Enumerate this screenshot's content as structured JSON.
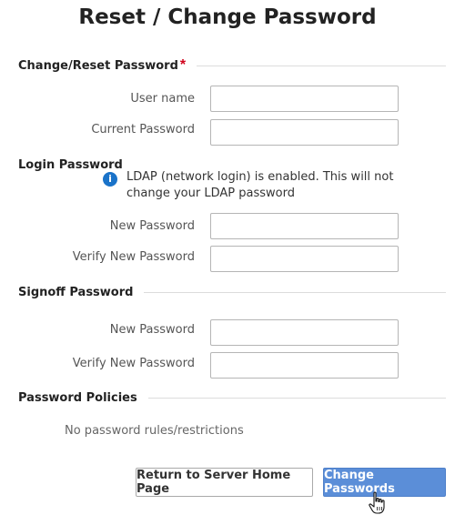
{
  "title": "Reset / Change Password",
  "sections": {
    "change_reset": {
      "label": "Change/Reset Password",
      "required_marker": "*"
    },
    "login": {
      "label": "Login Password"
    },
    "signoff": {
      "label": "Signoff Password"
    },
    "policies": {
      "label": "Password Policies"
    }
  },
  "fields": {
    "user_name": {
      "label": "User name",
      "value": ""
    },
    "current_password": {
      "label": "Current Password",
      "value": ""
    },
    "login_new": {
      "label": "New Password",
      "value": ""
    },
    "login_verify": {
      "label": "Verify New Password",
      "value": ""
    },
    "signoff_new": {
      "label": "New Password",
      "value": ""
    },
    "signoff_verify": {
      "label": "Verify New Password",
      "value": ""
    }
  },
  "info": {
    "icon": "info-icon",
    "glyph": "i",
    "text": "LDAP (network login) is enabled. This will not change your LDAP password"
  },
  "policies_text": "No password rules/restrictions",
  "buttons": {
    "return_home": "Return to Server Home Page",
    "change_passwords": "Change Passwords"
  },
  "colors": {
    "primary": "#5b8ed8",
    "info_icon": "#1a73c9",
    "required": "#d0021b"
  }
}
